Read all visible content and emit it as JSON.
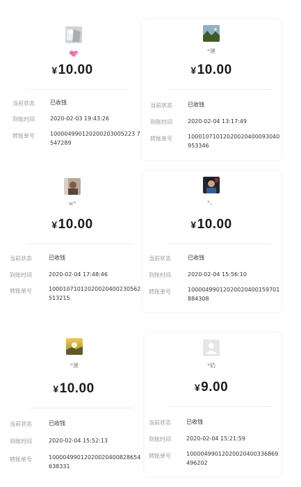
{
  "labels": {
    "status": "当前状态",
    "time": "到账时间",
    "order": "转账单号"
  },
  "currency": "¥",
  "records": [
    {
      "nickname": "",
      "avatar": "photo-avatar-icon",
      "amount": "10.00",
      "status": "已收钱",
      "time": "2020-02-03 19:43:26",
      "order_line1": "100004990120200203005223 72",
      "order_line2": "547289"
    },
    {
      "nickname": "*建",
      "avatar": "landscape-avatar-icon",
      "amount": "10.00",
      "status": "已收钱",
      "time": "2020-02-04 13:17:49",
      "order_line1": "10001071012020020400093040",
      "order_line2": "953346"
    },
    {
      "nickname": "w*",
      "avatar": "portrait-avatar-icon",
      "amount": "10.00",
      "status": "已收钱",
      "time": "2020-02-04 17:48:46",
      "order_line1": "10001071012020020400230562",
      "order_line2": "513215"
    },
    {
      "nickname": "*。",
      "avatar": "portrait-dark-avatar-icon",
      "amount": "10.00",
      "status": "已收钱",
      "time": "2020-02-04 15:56:10",
      "order_line1": "10000499012020020400159701",
      "order_line2": "884308"
    },
    {
      "nickname": "*建",
      "avatar": "sunset-avatar-icon",
      "amount": "10.00",
      "status": "已收钱",
      "time": "2020-02-04 15:52:13",
      "order_line1": "10000499012020020400828654",
      "order_line2": "638331"
    },
    {
      "nickname": "*奶",
      "avatar": "default-user-avatar-icon",
      "amount": "9.00",
      "status": "已收钱",
      "time": "2020-02-04 15:21:59",
      "order_line1": "10000499012020020400336869",
      "order_line2": "496202"
    }
  ]
}
